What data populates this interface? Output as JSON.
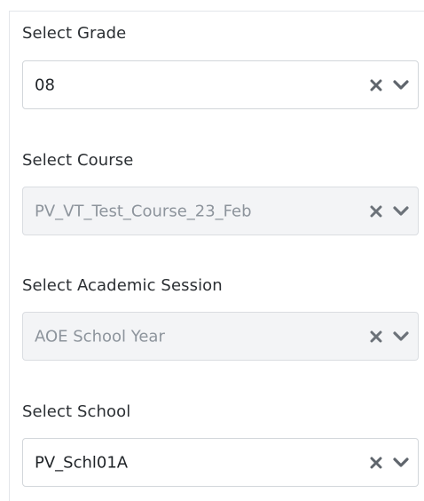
{
  "filters": [
    {
      "label": "Select Grade",
      "value": "08",
      "disabled": false
    },
    {
      "label": "Select Course",
      "value": "PV_VT_Test_Course_23_Feb",
      "disabled": true
    },
    {
      "label": "Select Academic Session",
      "value": "AOE School Year",
      "disabled": true
    },
    {
      "label": "Select School",
      "value": "PV_Schl01A",
      "disabled": false
    }
  ],
  "icons": {
    "clear": "clear-x-icon",
    "dropdown": "chevron-down-icon"
  },
  "colors": {
    "text": "#2b2f33",
    "disabled_text": "#8d949c",
    "disabled_bg": "#f3f4f6",
    "border": "#d2d6da",
    "icon": "#5f656c"
  }
}
